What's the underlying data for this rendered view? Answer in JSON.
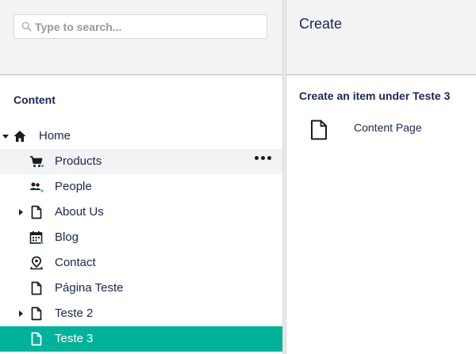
{
  "search": {
    "placeholder": "Type to search..."
  },
  "tree": {
    "title": "Content",
    "items": [
      {
        "label": "Home",
        "icon": "home-icon",
        "caret": "down",
        "level": 0
      },
      {
        "label": "Products",
        "icon": "shopping-cart-icon",
        "caret": "",
        "level": 1,
        "state": "hover",
        "actions": "more"
      },
      {
        "label": "People",
        "icon": "users-icon",
        "caret": "",
        "level": 1
      },
      {
        "label": "About Us",
        "icon": "document-icon",
        "caret": "right",
        "level": 1
      },
      {
        "label": "Blog",
        "icon": "calendar-icon",
        "caret": "",
        "level": 1
      },
      {
        "label": "Contact",
        "icon": "map-pin-icon",
        "caret": "",
        "level": 1
      },
      {
        "label": "Página Teste",
        "icon": "document-icon",
        "caret": "",
        "level": 1
      },
      {
        "label": "Teste 2",
        "icon": "document-icon",
        "caret": "right",
        "level": 1
      },
      {
        "label": "Teste 3",
        "icon": "document-icon",
        "caret": "",
        "level": 1,
        "state": "selected"
      }
    ]
  },
  "create": {
    "title": "Create",
    "subtitle": "Create an item under Teste 3",
    "items": [
      {
        "label": "Content Page",
        "icon": "document-icon"
      }
    ]
  },
  "colors": {
    "accent_selected": "#00b29a",
    "hover_row": "#f3f3f5",
    "header_bg": "#f3f3f5",
    "text": "#1b264f"
  }
}
